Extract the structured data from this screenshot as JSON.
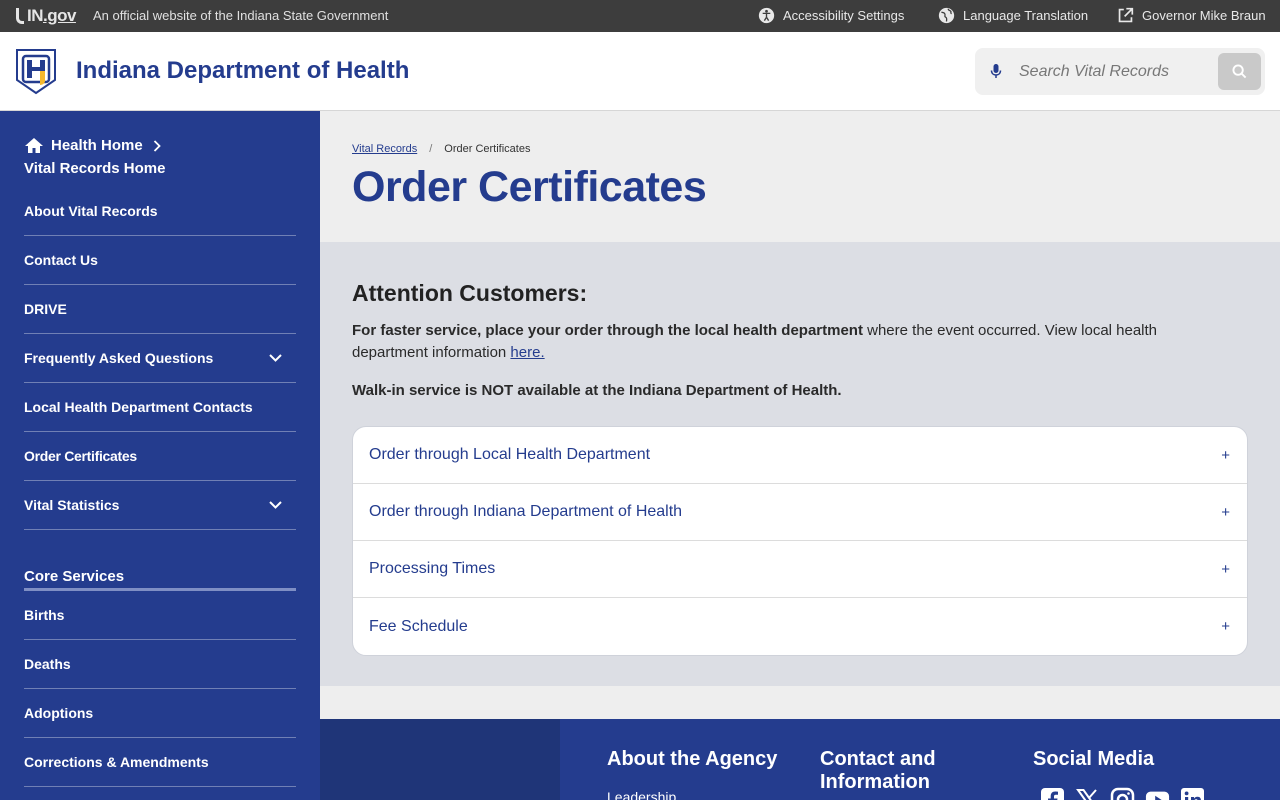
{
  "topbar": {
    "brand": "IN",
    "brand_suffix": ".gov",
    "official": "An official website of the Indiana State Government",
    "accessibility": "Accessibility Settings",
    "language": "Language Translation",
    "governor": "Governor Mike Braun"
  },
  "header": {
    "title": "Indiana Department of Health",
    "search_placeholder": "Search Vital Records"
  },
  "sidebar": {
    "home": "Health Home",
    "section_home": "Vital Records Home",
    "items": [
      {
        "label": "About Vital Records"
      },
      {
        "label": "Contact Us"
      },
      {
        "label": "DRIVE"
      },
      {
        "label": "Frequently Asked Questions"
      },
      {
        "label": "Local Health Department Contacts"
      },
      {
        "label": "Order Certificates"
      },
      {
        "label": "Vital Statistics"
      }
    ],
    "core_title": "Core Services",
    "core_items": [
      {
        "label": "Births"
      },
      {
        "label": "Deaths"
      },
      {
        "label": "Adoptions"
      },
      {
        "label": "Corrections & Amendments"
      }
    ]
  },
  "main": {
    "breadcrumb_parent": "Vital Records",
    "breadcrumb_sep": "/",
    "breadcrumb_current": "Order Certificates",
    "title": "Order Certificates",
    "attention": "Attention Customers:",
    "p1_bold": "For faster service, place your order through the local health department",
    "p1_rest": " where the event occurred. View local health department information ",
    "p1_link": "here.",
    "p2": "Walk-in service is NOT available at the Indiana Department of Health.",
    "accordion": [
      {
        "label": "Order through Local Health Department",
        "icon": "+"
      },
      {
        "label": "Order through Indiana Department of Health",
        "icon": "+"
      },
      {
        "label": "Processing Times",
        "icon": "+"
      },
      {
        "label": "Fee Schedule",
        "icon": "+"
      }
    ]
  },
  "footer": {
    "about": "About the Agency",
    "contact": "Contact and Information",
    "social": "Social Media",
    "leadership": "Leadership",
    "social_icons": [
      "facebook-icon",
      "x-icon",
      "instagram-icon",
      "youtube-icon",
      "linkedin-icon"
    ]
  },
  "colors": {
    "brand_blue": "#243c8e",
    "topbar": "#3d3d3d",
    "logo_yellow": "#f5b82e"
  }
}
